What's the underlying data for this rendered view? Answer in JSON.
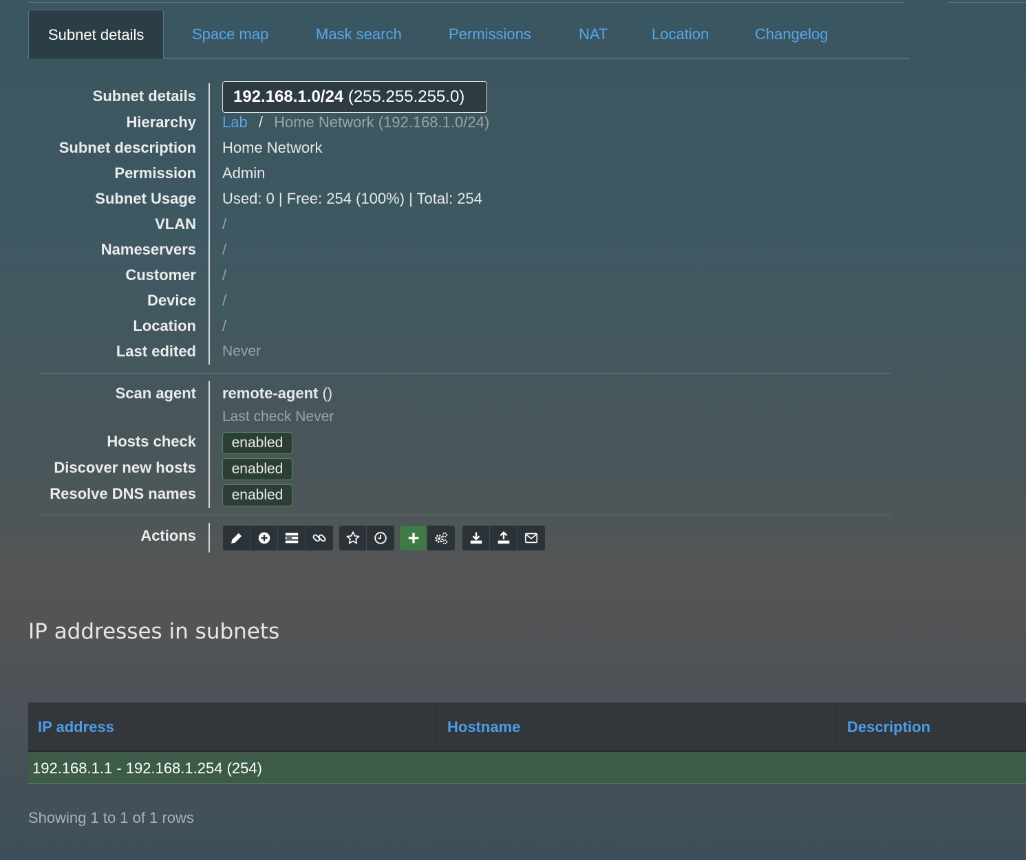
{
  "tabs": [
    {
      "label": "Subnet details"
    },
    {
      "label": "Space map"
    },
    {
      "label": "Mask search"
    },
    {
      "label": "Permissions"
    },
    {
      "label": "NAT"
    },
    {
      "label": "Location"
    },
    {
      "label": "Changelog"
    }
  ],
  "details": {
    "subnet_label": "Subnet details",
    "subnet_cidr": "192.168.1.0/24",
    "subnet_mask": " (255.255.255.0)",
    "hierarchy_label": "Hierarchy",
    "hierarchy_root": "Lab",
    "hierarchy_sep": "/",
    "hierarchy_current": "Home Network (192.168.1.0/24)",
    "description_label": "Subnet description",
    "description_value": "Home Network",
    "permission_label": "Permission",
    "permission_value": "Admin",
    "usage_label": "Subnet Usage",
    "usage_value": "Used: 0 | Free: 254 (100%) | Total: 254",
    "vlan_label": "VLAN",
    "vlan_value": "/",
    "nameservers_label": "Nameservers",
    "nameservers_value": "/",
    "customer_label": "Customer",
    "customer_value": "/",
    "device_label": "Device",
    "device_value": "/",
    "location_label": "Location",
    "location_value": "/",
    "last_edited_label": "Last edited",
    "last_edited_value": "Never"
  },
  "scan": {
    "agent_label": "Scan agent",
    "agent_name": "remote-agent",
    "agent_suffix": " ()",
    "last_check": "Last check Never",
    "hosts_check_label": "Hosts check",
    "hosts_check_value": "enabled",
    "discover_label": "Discover new hosts",
    "discover_value": "enabled",
    "resolve_label": "Resolve DNS names",
    "resolve_value": "enabled"
  },
  "actions": {
    "label": "Actions",
    "icons": [
      "pencil-icon",
      "plus-circle-icon",
      "server-icon",
      "link-icon",
      "star-icon",
      "clock-icon",
      "plus-icon",
      "cogs-icon",
      "download-icon",
      "upload-icon",
      "envelope-icon"
    ]
  },
  "ip_section": {
    "title": "IP addresses in subnets",
    "columns": [
      "IP address",
      "Hostname",
      "Description"
    ],
    "rows": [
      {
        "range": "192.168.1.1 - 192.168.1.254 (254)"
      }
    ],
    "footer": "Showing 1 to 1 of 1 rows"
  },
  "colors": {
    "link": "#55a6ea",
    "badge_border": "#4f8a55",
    "free_row": "#3d5c48",
    "green_button": "#3f7a44"
  }
}
